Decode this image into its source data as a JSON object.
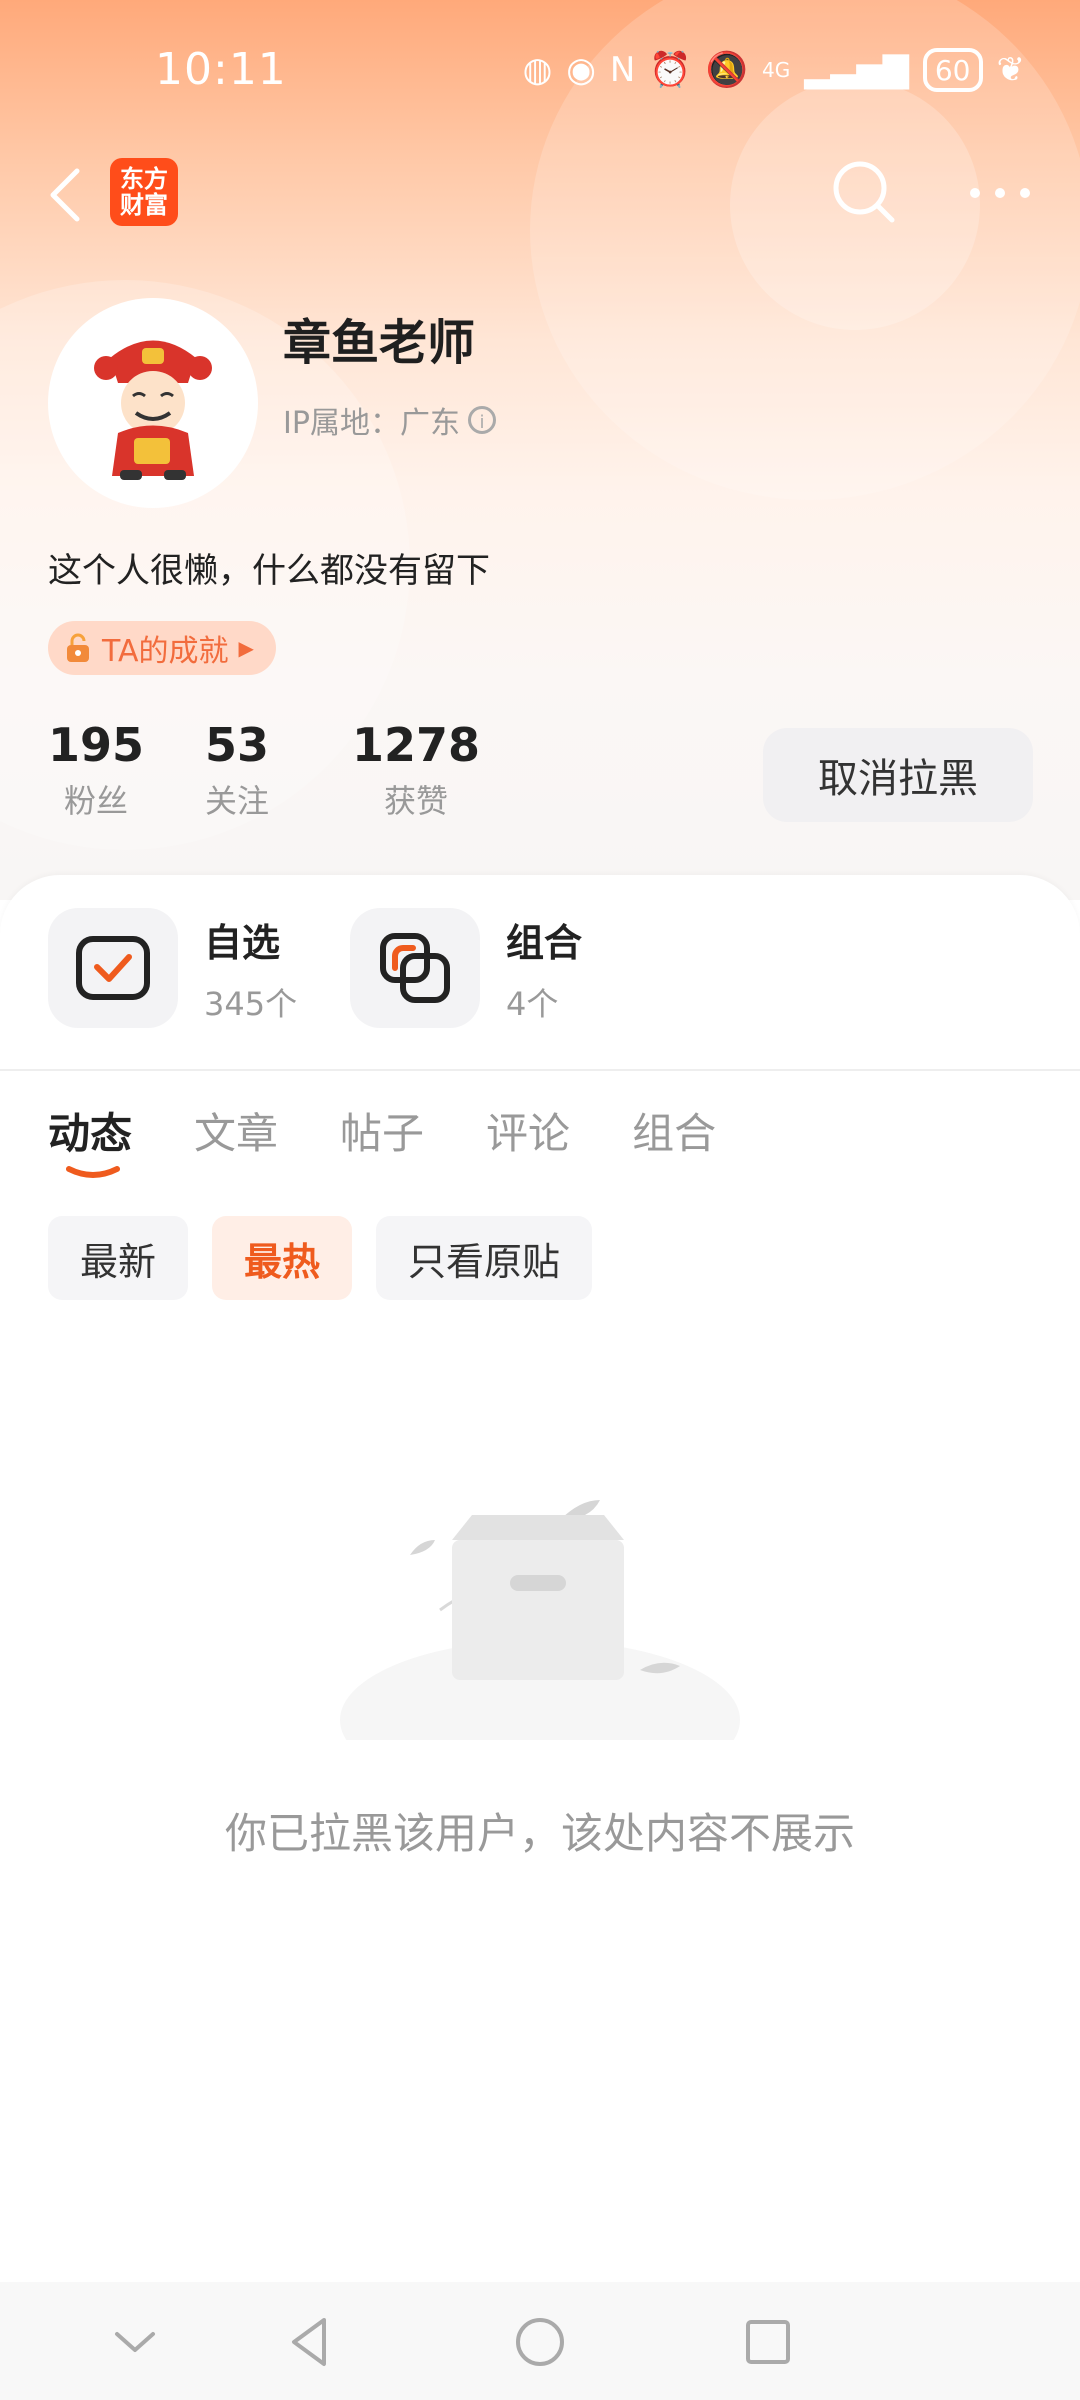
{
  "status_bar": {
    "time": "10:11",
    "battery": "60",
    "network": "4G"
  },
  "header": {
    "logo_text_line1": "东方",
    "logo_text_line2": "财富"
  },
  "profile": {
    "name": "章鱼老师",
    "ip_location": "IP属地：广东",
    "bio": "这个人很懒，什么都没有留下",
    "achievement_label": "TA的成就"
  },
  "stats": [
    {
      "value": "195",
      "label": "粉丝"
    },
    {
      "value": "53",
      "label": "关注"
    },
    {
      "value": "1278",
      "label": "获赞"
    }
  ],
  "unblock_button": "取消拉黑",
  "shortcuts": [
    {
      "title": "自选",
      "count": "345个",
      "icon": "watchlist-check-icon"
    },
    {
      "title": "组合",
      "count": "4个",
      "icon": "portfolio-icon"
    }
  ],
  "tabs": [
    "动态",
    "文章",
    "帖子",
    "评论",
    "组合"
  ],
  "active_tab": "动态",
  "filters": [
    "最新",
    "最热",
    "只看原贴"
  ],
  "active_filter": "最热",
  "empty_message": "你已拉黑该用户，该处内容不展示",
  "colors": {
    "accent": "#ef5b1e",
    "brand": "#ff4d1a",
    "hero_top": "#ffa97a"
  }
}
